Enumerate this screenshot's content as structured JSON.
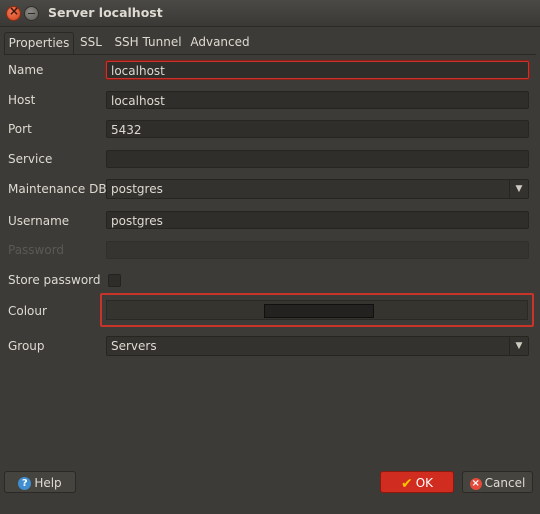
{
  "window": {
    "title": "Server localhost"
  },
  "tabs": [
    {
      "label": "Properties",
      "active": true
    },
    {
      "label": "SSL"
    },
    {
      "label": "SSH Tunnel"
    },
    {
      "label": "Advanced"
    }
  ],
  "form": {
    "name": {
      "label": "Name",
      "value": "localhost"
    },
    "host": {
      "label": "Host",
      "value": "localhost"
    },
    "port": {
      "label": "Port",
      "value": "5432"
    },
    "service": {
      "label": "Service",
      "value": ""
    },
    "maintenance_db": {
      "label": "Maintenance DB",
      "value": "postgres"
    },
    "username": {
      "label": "Username",
      "value": "postgres"
    },
    "password": {
      "label": "Password",
      "value": ""
    },
    "store_password": {
      "label": "Store password",
      "checked": false
    },
    "colour": {
      "label": "Colour"
    },
    "group": {
      "label": "Group",
      "value": "Servers"
    }
  },
  "buttons": {
    "help": "Help",
    "ok": "OK",
    "cancel": "Cancel"
  },
  "colors": {
    "accent": "#d02c1f",
    "background": "#3c3b37",
    "field": "#2f2e2b"
  }
}
